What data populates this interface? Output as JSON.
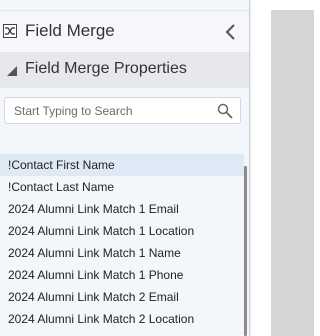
{
  "panel": {
    "title": "Field Merge",
    "header_icon": "field-merge-icon",
    "collapse_icon": "chevron-left-icon"
  },
  "section": {
    "title": "Field Merge Properties",
    "caret_icon": "collapse-caret-icon"
  },
  "search": {
    "placeholder": "Start Typing to Search",
    "value": "",
    "icon": "search-icon"
  },
  "fields": [
    {
      "label": "!Contact First Name",
      "selected": true
    },
    {
      "label": "!Contact Last Name",
      "selected": false
    },
    {
      "label": "2024 Alumni Link Match 1 Email",
      "selected": false
    },
    {
      "label": "2024 Alumni Link Match 1 Location",
      "selected": false
    },
    {
      "label": "2024 Alumni Link Match 1 Name",
      "selected": false
    },
    {
      "label": "2024 Alumni Link Match 1 Phone",
      "selected": false
    },
    {
      "label": "2024 Alumni Link Match 2 Email",
      "selected": false
    },
    {
      "label": "2024 Alumni Link Match 2 Location",
      "selected": false
    }
  ],
  "colors": {
    "panel_bg": "#f3f6fa",
    "section_bg": "#e6e8ec",
    "selected_row": "#dfe9f5",
    "canvas_gray": "#d5d5d5"
  }
}
